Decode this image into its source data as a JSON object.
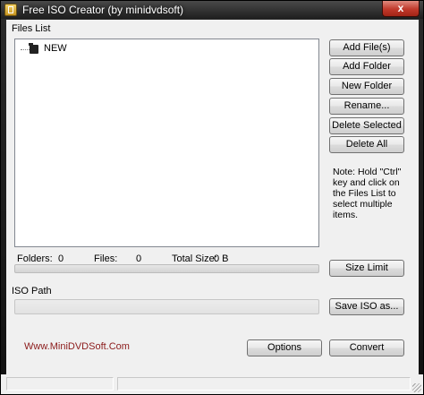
{
  "window": {
    "title": "Free ISO Creator (by minidvdsoft)",
    "close_glyph": "x",
    "icon": "app-icon"
  },
  "files_list": {
    "label": "Files List",
    "tree": [
      {
        "label": "NEW",
        "icon": "folder-icon"
      }
    ]
  },
  "buttons": {
    "add_files": "Add File(s)",
    "add_folder": "Add Folder",
    "new_folder": "New Folder",
    "rename": "Rename...",
    "delete_selected": "Delete Selected",
    "delete_all": "Delete All",
    "size_limit": "Size Limit",
    "save_iso": "Save ISO as...",
    "options": "Options",
    "convert": "Convert"
  },
  "note": "Note: Hold \"Ctrl\" key and click on the Files List to select multiple items.",
  "stats": {
    "folders_label": "Folders:",
    "folders_value": "0",
    "files_label": "Files:",
    "files_value": "0",
    "total_size_label": "Total Size:",
    "total_size_value": "0 B"
  },
  "progress": {
    "value": 0
  },
  "iso_path": {
    "label": "ISO Path",
    "value": ""
  },
  "website": "Www.MiniDVDSoft.Com",
  "colors": {
    "website_text": "#8b1a1a",
    "close_button": "#c0392b",
    "titlebar": "#2b2b2b"
  }
}
